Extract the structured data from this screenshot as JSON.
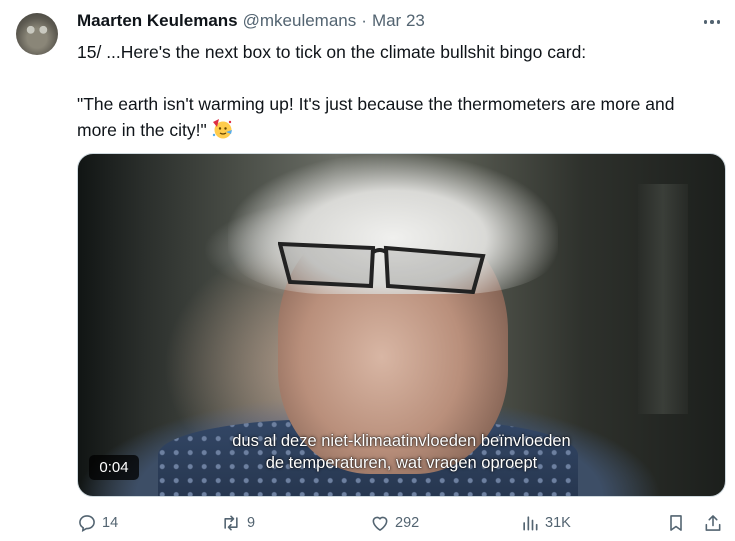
{
  "author": {
    "name": "Maarten Keulemans",
    "handle": "@mkeulemans",
    "separator": "·",
    "date": "Mar 23"
  },
  "tweet": {
    "line1": "15/ ...Here's the next box to tick on the climate bullshit bingo card:",
    "line2": "\"The earth isn't warming up! It's just because the thermometers are more and more in the city!\"",
    "emoji": "partying-face"
  },
  "video": {
    "subtitle_line1": "dus al deze niet-klimaatinvloeden beïnvloeden",
    "subtitle_line2": "de temperaturen, wat vragen oproept",
    "timestamp": "0:04"
  },
  "actions": {
    "replies": "14",
    "reposts": "9",
    "likes": "292",
    "views": "31K"
  },
  "colors": {
    "text": "#0f1419",
    "secondary": "#536471"
  }
}
